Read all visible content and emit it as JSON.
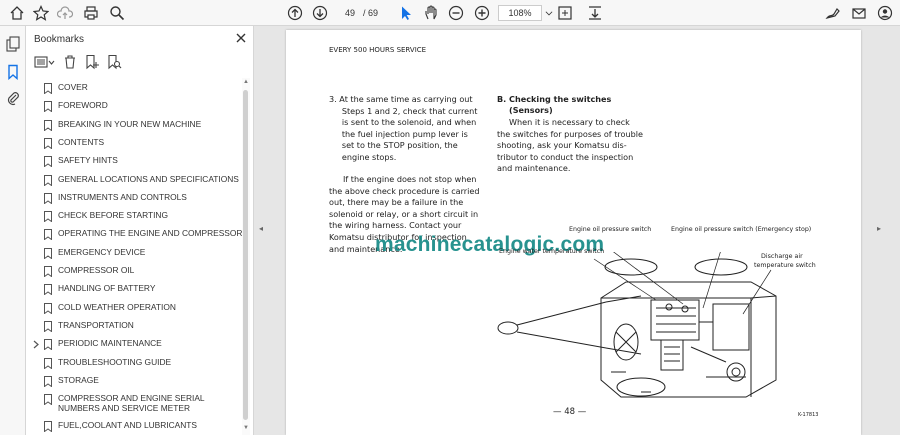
{
  "toolbar": {
    "page_current": "49",
    "page_total": "/ 69",
    "zoom": "108%"
  },
  "bookmarks": {
    "title": "Bookmarks",
    "items": [
      {
        "label": "COVER"
      },
      {
        "label": "FOREWORD"
      },
      {
        "label": "BREAKING IN YOUR NEW MACHINE"
      },
      {
        "label": "CONTENTS"
      },
      {
        "label": "SAFETY HINTS"
      },
      {
        "label": "GENERAL LOCATIONS AND SPECIFICATIONS"
      },
      {
        "label": "INSTRUMENTS AND CONTROLS"
      },
      {
        "label": "CHECK BEFORE STARTING"
      },
      {
        "label": "OPERATING THE ENGINE AND COMPRESSOR"
      },
      {
        "label": "EMERGENCY DEVICE"
      },
      {
        "label": "COMPRESSOR OIL"
      },
      {
        "label": "HANDLING OF BATTERY"
      },
      {
        "label": "COLD WEATHER OPERATION"
      },
      {
        "label": "TRANSPORTATION"
      },
      {
        "label": "PERIODIC MAINTENANCE"
      },
      {
        "label": "TROUBLESHOOTING GUIDE"
      },
      {
        "label": "STORAGE"
      },
      {
        "label": "COMPRESSOR AND ENGINE SERIAL NUMBERS AND SERVICE METER"
      },
      {
        "label": "FUEL,COOLANT AND LUBRICANTS"
      }
    ]
  },
  "document": {
    "header": "EVERY 500 HOURS SERVICE",
    "para3_lines": [
      "3.  At the same time as carrying out",
      "     Steps 1 and 2, check that current",
      "     is sent to the solenoid, and when",
      "     the fuel injection pump lever is",
      "     set to the STOP position, the",
      "     engine stops."
    ],
    "para_if_lines": [
      "If the engine does not stop when",
      "the above check procedure is carried",
      "out, there may be a failure in the",
      "solenoid or relay, or a short circuit in",
      "the wiring harness. Contact your",
      "Komatsu distributor for inspection",
      "and maintenance."
    ],
    "sectionB_title_1": "B.  Checking the switches",
    "sectionB_title_2": "(Sensors)",
    "sectionB_lines": [
      "When it is necessary to check",
      "the switches for purposes of trouble",
      "shooting, ask your Komatsu dis-",
      "tributor to conduct the inspection",
      "and maintenance."
    ],
    "watermark": "machinecatalogic.com",
    "fig_labels": {
      "oil_pressure": "Engine oil pressure switch",
      "oil_pressure_emergency": "Engine oil pressure switch (Emergency stop)",
      "water_temp": "Engine water temperature switch",
      "discharge_air_1": "Discharge air",
      "discharge_air_2": "temperature switch"
    },
    "page_number": "— 48 —",
    "fig_code": "K-17813"
  }
}
